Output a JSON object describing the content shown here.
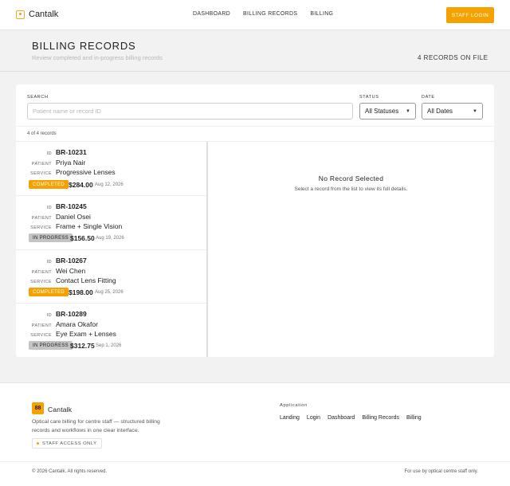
{
  "nav": {
    "brand": "Cantalk",
    "links": [
      "DASHBOARD",
      "BILLING RECORDS",
      "BILLING"
    ],
    "login_label": "STAFF LOGIN"
  },
  "header": {
    "title": "BILLING RECORDS",
    "subtitle": "Review completed and in-progress billing records",
    "records_count": "4 RECORDS ON FILE"
  },
  "filters": {
    "search_label": "SEARCH",
    "search_placeholder": "Patient name or record ID",
    "search_value": "",
    "status_label": "STATUS",
    "status_selected": "All Statuses",
    "date_label": "DATE",
    "date_selected": "All Dates"
  },
  "list": {
    "meta": "4 of 4 records",
    "field_labels": {
      "id": "ID",
      "patient": "PATIENT",
      "service": "SERVICE"
    },
    "records": [
      {
        "id": "BR-10231",
        "patient": "Priya Nair",
        "service": "Progressive Lenses",
        "status": "COMPLETED",
        "status_kind": "completed",
        "amount": "$284.00",
        "date": "Aug 12, 2026"
      },
      {
        "id": "BR-10245",
        "patient": "Daniel Osei",
        "service": "Frame + Single Vision",
        "status": "IN PROGRESS",
        "status_kind": "progress",
        "amount": "$156.50",
        "date": "Aug 19, 2026"
      },
      {
        "id": "BR-10267",
        "patient": "Wei Chen",
        "service": "Contact Lens Fitting",
        "status": "COMPLETED",
        "status_kind": "completed",
        "amount": "$198.00",
        "date": "Aug 25, 2026"
      },
      {
        "id": "BR-10289",
        "patient": "Amara Okafor",
        "service": "Eye Exam + Lenses",
        "status": "IN PROGRESS",
        "status_kind": "progress",
        "amount": "$312.75",
        "date": "Sep 1, 2026"
      }
    ]
  },
  "detail": {
    "empty_title": "No Record Selected",
    "empty_desc": "Select a record from the list to view its full details."
  },
  "footer": {
    "logo_text": "88",
    "brand": "Cantalk",
    "description": "Optical care billing for centre staff — structured billing records and workflows in one clear interface.",
    "badge": "STAFF ACCESS ONLY",
    "app_title": "Application",
    "links": [
      "Landing",
      "Login",
      "Dashboard",
      "Billing Records",
      "Billing"
    ],
    "copyright": "© 2026 Cantalk. All rights reserved.",
    "note": "For use by optical centre staff only."
  },
  "colors": {
    "accent": "#f5a200",
    "badge_progress": "#c4c4c4",
    "background": "#f2f2f2"
  }
}
